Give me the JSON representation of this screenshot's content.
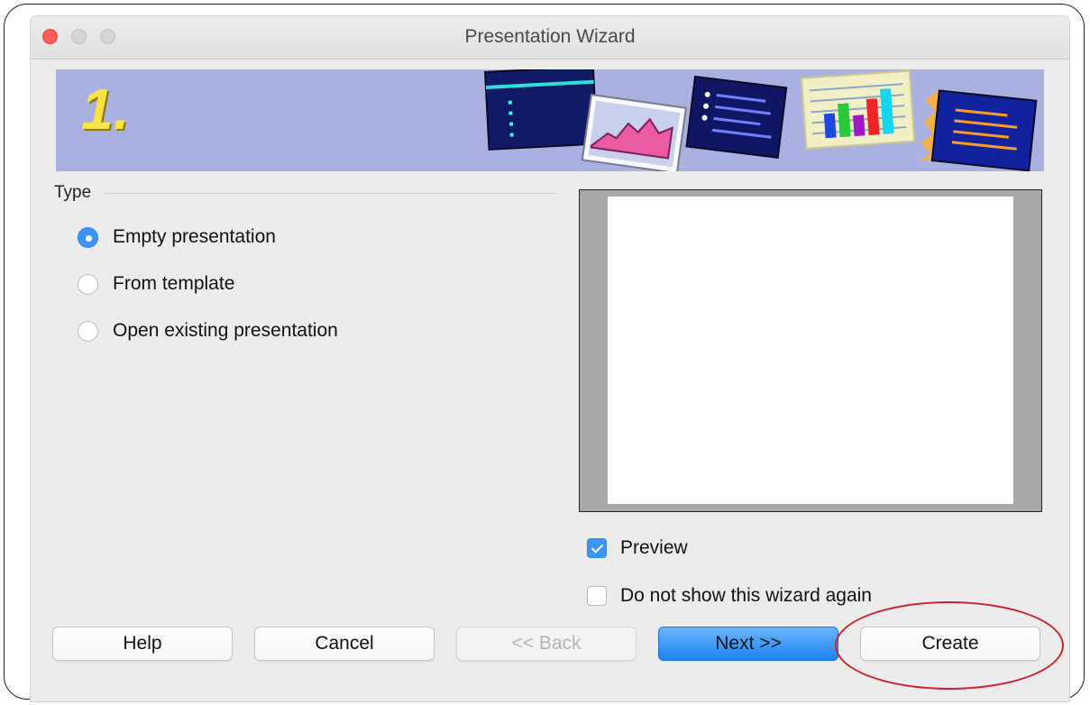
{
  "window": {
    "title": "Presentation Wizard"
  },
  "banner": {
    "step": "1.",
    "background_color": "#a9b1e0"
  },
  "type_section": {
    "label": "Type",
    "options": [
      {
        "label": "Empty presentation",
        "selected": true
      },
      {
        "label": "From template",
        "selected": false
      },
      {
        "label": "Open existing presentation",
        "selected": false
      }
    ]
  },
  "preview": {
    "checkbox_label": "Preview",
    "checked": true
  },
  "dont_show": {
    "checkbox_label": "Do not show this wizard again",
    "checked": false
  },
  "buttons": {
    "help": "Help",
    "cancel": "Cancel",
    "back": "<< Back",
    "next": "Next >>",
    "create": "Create"
  },
  "colors": {
    "accent": "#3d94f6",
    "highlight": "#cf1f2a"
  },
  "icons": {
    "close": "close-traffic-light",
    "minimize": "minimize-traffic-light",
    "zoom": "zoom-traffic-light"
  }
}
